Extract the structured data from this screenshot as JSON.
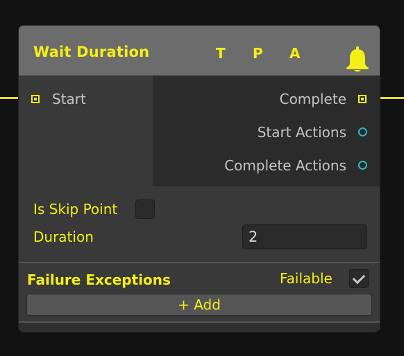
{
  "node": {
    "title": "Wait Duration",
    "header_buttons": {
      "t": "T",
      "p": "P",
      "a": "A"
    },
    "bell_icon": "bell-icon"
  },
  "ports": {
    "inputs": [
      {
        "label": "Start",
        "type": "flow"
      }
    ],
    "outputs": [
      {
        "label": "Complete",
        "type": "flow"
      },
      {
        "label": "Start Actions",
        "type": "action"
      },
      {
        "label": "Complete Actions",
        "type": "action"
      }
    ]
  },
  "fields": {
    "is_skip_point": {
      "label": "Is Skip Point",
      "checked": false
    },
    "duration": {
      "label": "Duration",
      "value": "2"
    }
  },
  "failure": {
    "title": "Failure Exceptions",
    "failable_label": "Failable",
    "failable_checked": true,
    "add_label": "+ Add"
  },
  "colors": {
    "accent": "#f5ef18",
    "action_port": "#27b8c8",
    "header": "#6c6c6c",
    "body": "#393939",
    "background": "#121212"
  }
}
